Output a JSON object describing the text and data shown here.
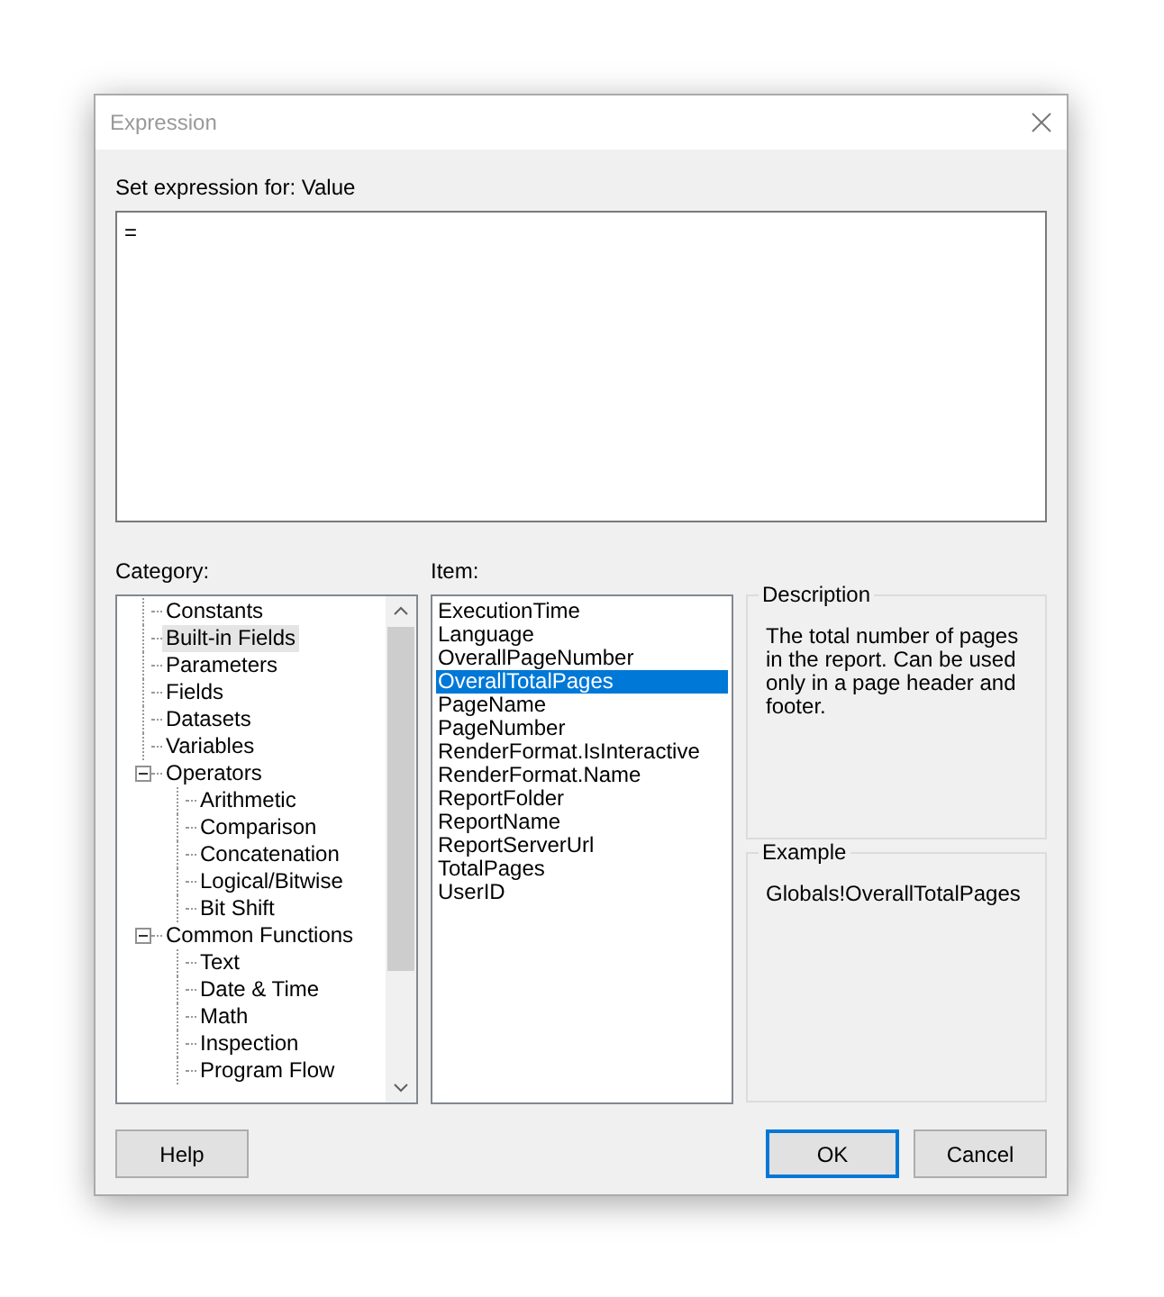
{
  "window": {
    "title": "Expression"
  },
  "expression": {
    "label": "Set expression for: Value",
    "value": "="
  },
  "category": {
    "label": "Category:",
    "items": [
      {
        "label": "Constants",
        "selected": false
      },
      {
        "label": "Built-in Fields",
        "selected": true
      },
      {
        "label": "Parameters",
        "selected": false
      },
      {
        "label": "Fields",
        "selected": false
      },
      {
        "label": "Datasets",
        "selected": false
      },
      {
        "label": "Variables",
        "selected": false
      },
      {
        "label": "Operators",
        "selected": false,
        "expanded": true,
        "children": [
          {
            "label": "Arithmetic",
            "selected": false
          },
          {
            "label": "Comparison",
            "selected": false
          },
          {
            "label": "Concatenation",
            "selected": false
          },
          {
            "label": "Logical/Bitwise",
            "selected": false
          },
          {
            "label": "Bit Shift",
            "selected": false
          }
        ]
      },
      {
        "label": "Common Functions",
        "selected": false,
        "expanded": true,
        "children": [
          {
            "label": "Text",
            "selected": false
          },
          {
            "label": "Date & Time",
            "selected": false
          },
          {
            "label": "Math",
            "selected": false
          },
          {
            "label": "Inspection",
            "selected": false
          },
          {
            "label": "Program Flow",
            "selected": false
          }
        ]
      }
    ]
  },
  "item": {
    "label": "Item:",
    "items": [
      {
        "label": "ExecutionTime",
        "selected": false
      },
      {
        "label": "Language",
        "selected": false
      },
      {
        "label": "OverallPageNumber",
        "selected": false
      },
      {
        "label": "OverallTotalPages",
        "selected": true
      },
      {
        "label": "PageName",
        "selected": false
      },
      {
        "label": "PageNumber",
        "selected": false
      },
      {
        "label": "RenderFormat.IsInteractive",
        "selected": false
      },
      {
        "label": "RenderFormat.Name",
        "selected": false
      },
      {
        "label": "ReportFolder",
        "selected": false
      },
      {
        "label": "ReportName",
        "selected": false
      },
      {
        "label": "ReportServerUrl",
        "selected": false
      },
      {
        "label": "TotalPages",
        "selected": false
      },
      {
        "label": "UserID",
        "selected": false
      }
    ]
  },
  "description": {
    "title": "Description",
    "text": "The total number of pages in the report. Can be used only in a page header and footer."
  },
  "example": {
    "title": "Example",
    "text": "Globals!OverallTotalPages"
  },
  "buttons": [
    {
      "label": "Help",
      "default": false
    },
    {
      "label": "OK",
      "default": true
    },
    {
      "label": "Cancel",
      "default": false
    }
  ]
}
